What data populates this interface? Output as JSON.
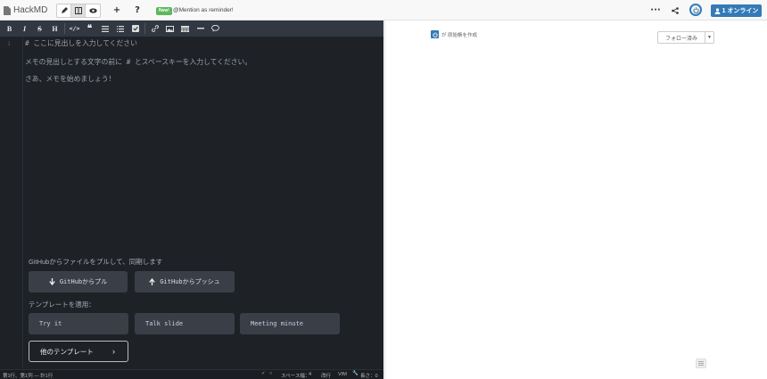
{
  "app": {
    "brand": "HackMD"
  },
  "navbar": {
    "new_badge": "New!",
    "new_message": "@Mention as reminder!",
    "online_label": "1 オンライン",
    "accent": "#337ab7"
  },
  "editor": {
    "toolbar": [
      "B",
      "I",
      "S",
      "H"
    ],
    "line_number": "1",
    "lines": [
      "# ここに見出しを入力してください",
      "メモの見出しとする文字の前に # とスペースキーを入力してください。",
      "さあ、メモを始めましょう！"
    ],
    "github_heading": "GitHubからファイルをプルして、同期します",
    "github_pull": "GitHubからプル",
    "github_push": "GitHubからプッシュ",
    "template_heading": "テンプレートを適用：",
    "templates": [
      "Try it",
      "Talk slide",
      "Meeting minute"
    ],
    "other_templates": "他のテンプレート"
  },
  "statusbar": {
    "position": "第1行、第1列 — 計1行",
    "spaces_label": "スペース幅：",
    "spaces_value": "4",
    "wrap": "改行",
    "keymap": "VIM",
    "length": "長さ：0"
  },
  "preview": {
    "author_note": "が 原始帳を作成",
    "follow_label": "フォロー済み"
  }
}
